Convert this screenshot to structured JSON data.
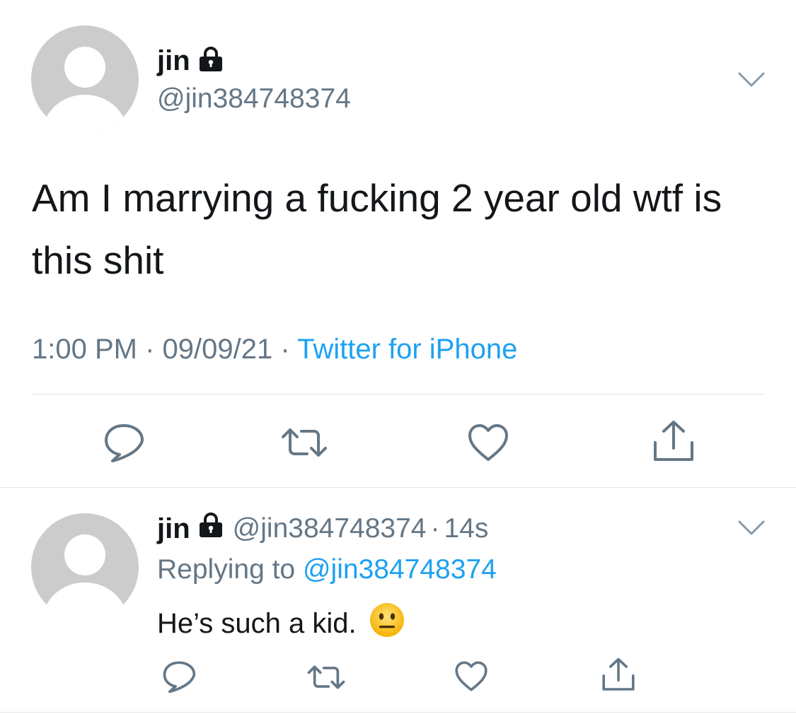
{
  "main_tweet": {
    "display_name": "jin",
    "handle": "@jin384748374",
    "text": "Am I marrying a fucking 2 year old wtf is this shit",
    "time": "1:00 PM",
    "date": "09/09/21",
    "source": "Twitter for iPhone",
    "separator": "·"
  },
  "reply_tweet": {
    "display_name": "jin",
    "handle": "@jin384748374",
    "separator": "·",
    "age": "14s",
    "replying_prefix": "Replying to",
    "replying_to": "@jin384748374",
    "text": "He’s such a kid."
  },
  "icons": {
    "lock": "lock-icon",
    "more": "chevron-down-icon",
    "reply": "reply-icon",
    "retweet": "retweet-icon",
    "like": "heart-icon",
    "share": "share-icon",
    "emoji": "neutral-face-emoji"
  },
  "colors": {
    "text": "#14171a",
    "secondary": "#657786",
    "link": "#1da1f2",
    "divider": "#e1e8ed",
    "avatar": "#cccccc"
  }
}
